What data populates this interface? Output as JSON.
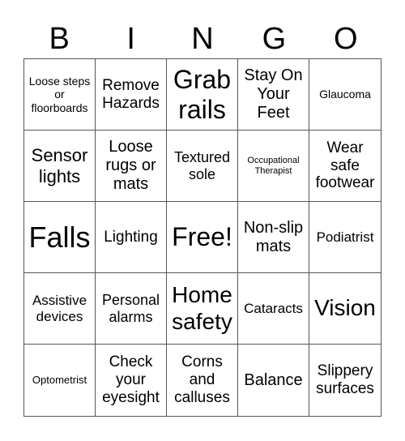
{
  "header": [
    "B",
    "I",
    "N",
    "G",
    "O"
  ],
  "cells": [
    "Loose steps or floorboards",
    "Remove Hazards",
    "Grab rails",
    "Stay On Your Feet",
    "Glaucoma",
    "Sensor lights",
    "Loose rugs or mats",
    "Textured sole",
    "Occupational Therapist",
    "Wear safe footwear",
    "Falls",
    "Lighting",
    "Free!",
    "Non-slip mats",
    "Podiatrist",
    "Assistive devices",
    "Personal alarms",
    "Home safety",
    "Cataracts",
    "Vision",
    "Optometrist",
    "Check your eyesight",
    "Corns and calluses",
    "Balance",
    "Slippery surfaces"
  ]
}
